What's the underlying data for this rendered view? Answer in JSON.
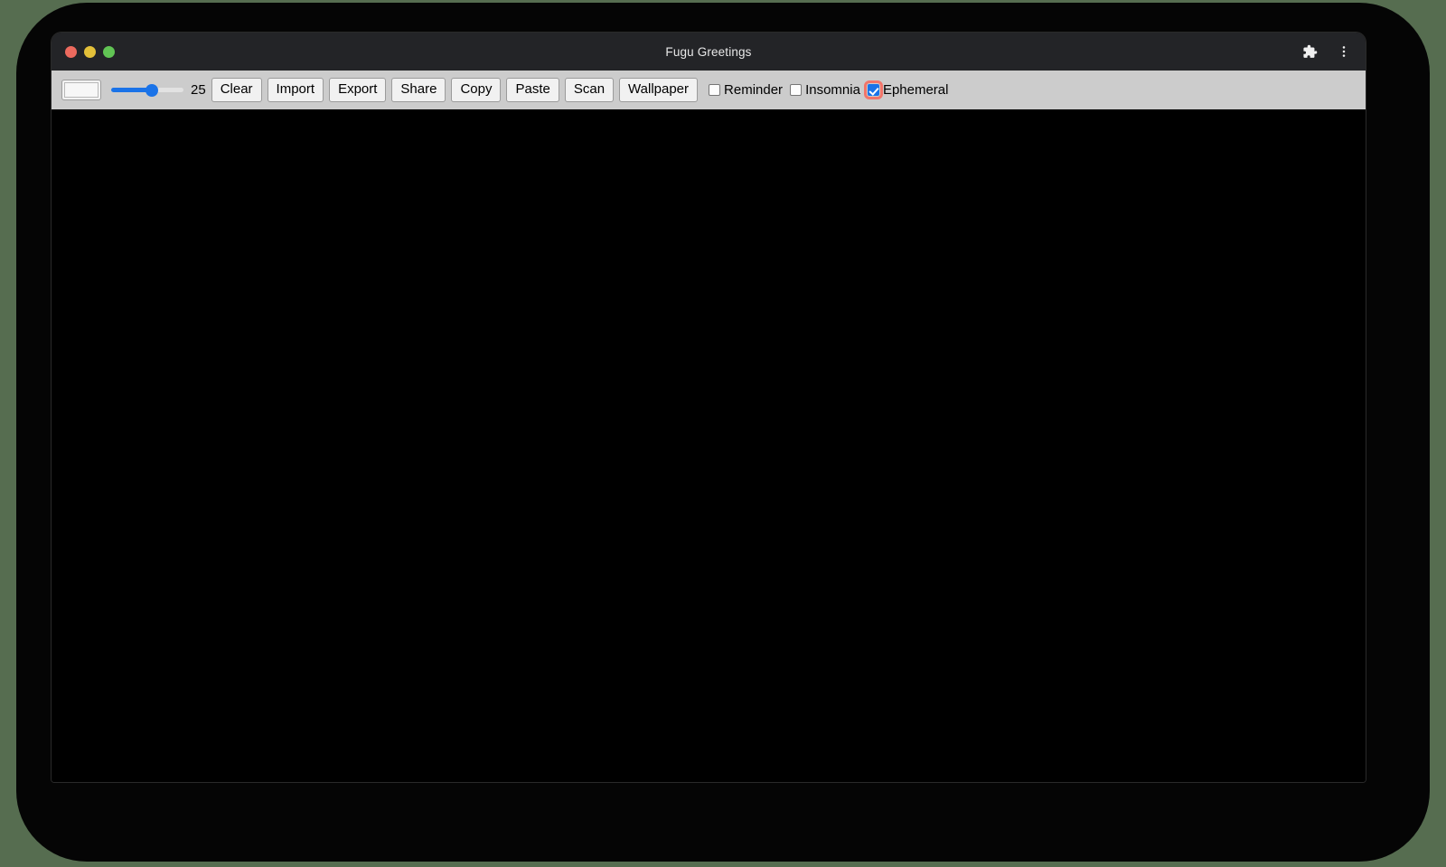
{
  "window": {
    "title": "Fugu Greetings",
    "traffic_lights": [
      {
        "name": "close",
        "color": "#ec6a5e"
      },
      {
        "name": "minimize",
        "color": "#e3c039"
      },
      {
        "name": "maximize",
        "color": "#61c454"
      }
    ],
    "titlebar_icons": [
      {
        "name": "extensions-icon"
      },
      {
        "name": "more-vert-icon"
      }
    ]
  },
  "toolbar": {
    "color_value": "#f7f7f7",
    "slider": {
      "value": "25",
      "min": "1",
      "max": "50",
      "percent": 48
    },
    "buttons": [
      {
        "label": "Clear"
      },
      {
        "label": "Import"
      },
      {
        "label": "Export"
      },
      {
        "label": "Share"
      },
      {
        "label": "Copy"
      },
      {
        "label": "Paste"
      },
      {
        "label": "Scan"
      },
      {
        "label": "Wallpaper"
      }
    ],
    "checkboxes": [
      {
        "label": "Reminder",
        "checked": false,
        "focused": false
      },
      {
        "label": "Insomnia",
        "checked": false,
        "focused": false
      },
      {
        "label": "Ephemeral",
        "checked": true,
        "focused": true
      }
    ]
  },
  "canvas": {
    "background": "#000000"
  },
  "colors": {
    "page_background": "#566d50",
    "backdrop": "#050505",
    "titlebar": "#232427",
    "toolbar": "#cccccc",
    "accent": "#1a73e8",
    "focus_ring": "#f2756a"
  }
}
